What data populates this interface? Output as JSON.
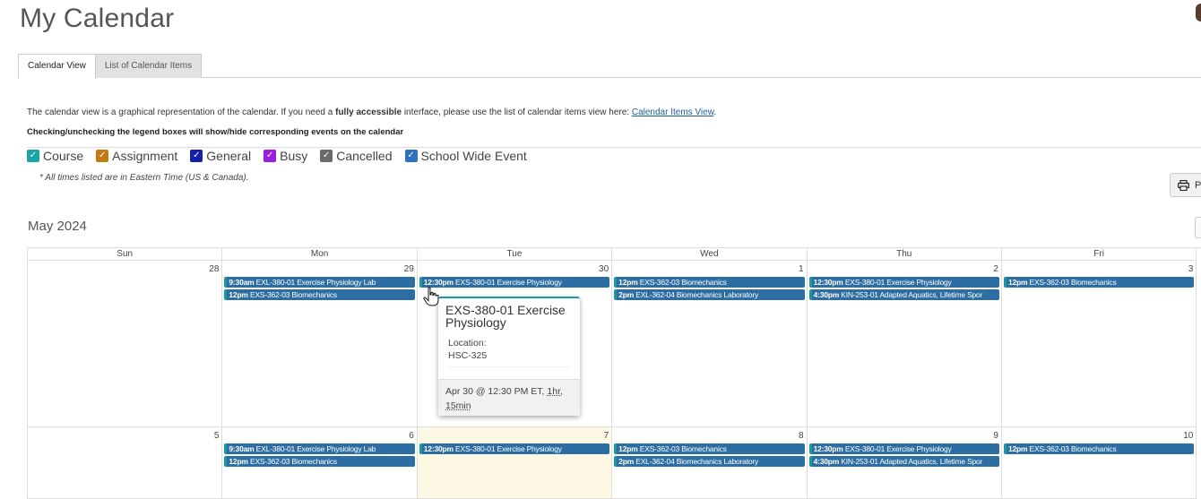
{
  "header": {
    "title": "My Calendar"
  },
  "tabs": [
    {
      "label": "Calendar View",
      "active": true
    },
    {
      "label": "List of Calendar Items",
      "active": false
    }
  ],
  "intro": {
    "prefix": "The calendar view is a graphical representation of the calendar. If you need a ",
    "bold": "fully accessible",
    "middle": " interface, please use the list of calendar items view here: ",
    "link": "Calendar Items View",
    "suffix": "."
  },
  "legend_hint": "Checking/unchecking the legend boxes will show/hide corresponding events on the calendar",
  "legend": [
    {
      "label": "Course",
      "color": "#1aa3a8",
      "checked": true
    },
    {
      "label": "Assignment",
      "color": "#c57a10",
      "checked": true
    },
    {
      "label": "General",
      "color": "#1420a8",
      "checked": true
    },
    {
      "label": "Busy",
      "color": "#9a1ee0",
      "checked": true
    },
    {
      "label": "Cancelled",
      "color": "#6b6b6b",
      "checked": true
    },
    {
      "label": "School Wide Event",
      "color": "#2e72c0",
      "checked": true
    }
  ],
  "timezone_note": "* All times listed are in Eastern Time (US & Canada).",
  "print_label": "P",
  "month_title": "May 2024",
  "weekdays": [
    "Sun",
    "Mon",
    "Tue",
    "Wed",
    "Thu",
    "Fri"
  ],
  "weeks": [
    {
      "days": [
        {
          "num": "28",
          "events": []
        },
        {
          "num": "29",
          "events": [
            {
              "time": "9:30am",
              "title": "EXL-380-01 Exercise Physiology Lab"
            },
            {
              "time": "12pm",
              "title": "EXS-362-03 Biomechanics"
            }
          ]
        },
        {
          "num": "30",
          "events": [
            {
              "time": "12:30pm",
              "title": "EXS-380-01 Exercise Physiology"
            }
          ]
        },
        {
          "num": "1",
          "events": [
            {
              "time": "12pm",
              "title": "EXS-362-03 Biomechanics"
            },
            {
              "time": "2pm",
              "title": "EXL-362-04 Biomechanics Laboratory"
            }
          ]
        },
        {
          "num": "2",
          "events": [
            {
              "time": "12:30pm",
              "title": "EXS-380-01 Exercise Physiology"
            },
            {
              "time": "4:30pm",
              "title": "KIN-253-01 Adapted Aquatics, Lifetime Spor"
            }
          ]
        },
        {
          "num": "3",
          "events": [
            {
              "time": "12pm",
              "title": "EXS-362-03 Biomechanics"
            }
          ]
        }
      ]
    },
    {
      "days": [
        {
          "num": "5",
          "events": []
        },
        {
          "num": "6",
          "events": [
            {
              "time": "9:30am",
              "title": "EXL-380-01 Exercise Physiology Lab"
            },
            {
              "time": "12pm",
              "title": "EXS-362-03 Biomechanics"
            }
          ]
        },
        {
          "num": "7",
          "today": true,
          "events": [
            {
              "time": "12:30pm",
              "title": "EXS-380-01 Exercise Physiology"
            }
          ]
        },
        {
          "num": "8",
          "events": [
            {
              "time": "12pm",
              "title": "EXS-362-03 Biomechanics"
            },
            {
              "time": "2pm",
              "title": "EXL-362-04 Biomechanics Laboratory"
            }
          ]
        },
        {
          "num": "9",
          "events": [
            {
              "time": "12:30pm",
              "title": "EXS-380-01 Exercise Physiology"
            },
            {
              "time": "4:30pm",
              "title": "KIN-253-01 Adapted Aquatics, Lifetime Spor"
            }
          ]
        },
        {
          "num": "10",
          "events": [
            {
              "time": "12pm",
              "title": "EXS-362-03 Biomechanics"
            }
          ]
        }
      ]
    }
  ],
  "popover": {
    "title": "EXS-380-01 Exercise Physiology",
    "location_label": "Location:",
    "location": "HSC-325",
    "when": "Apr 30 @ 12:30 PM ET,",
    "duration": "1hr, 15min"
  },
  "colors": {
    "event_bg": "#2c6ea3",
    "event_accent": "#1a9aa0",
    "today_bg": "#fcf8e3",
    "link": "#1f5a99"
  }
}
